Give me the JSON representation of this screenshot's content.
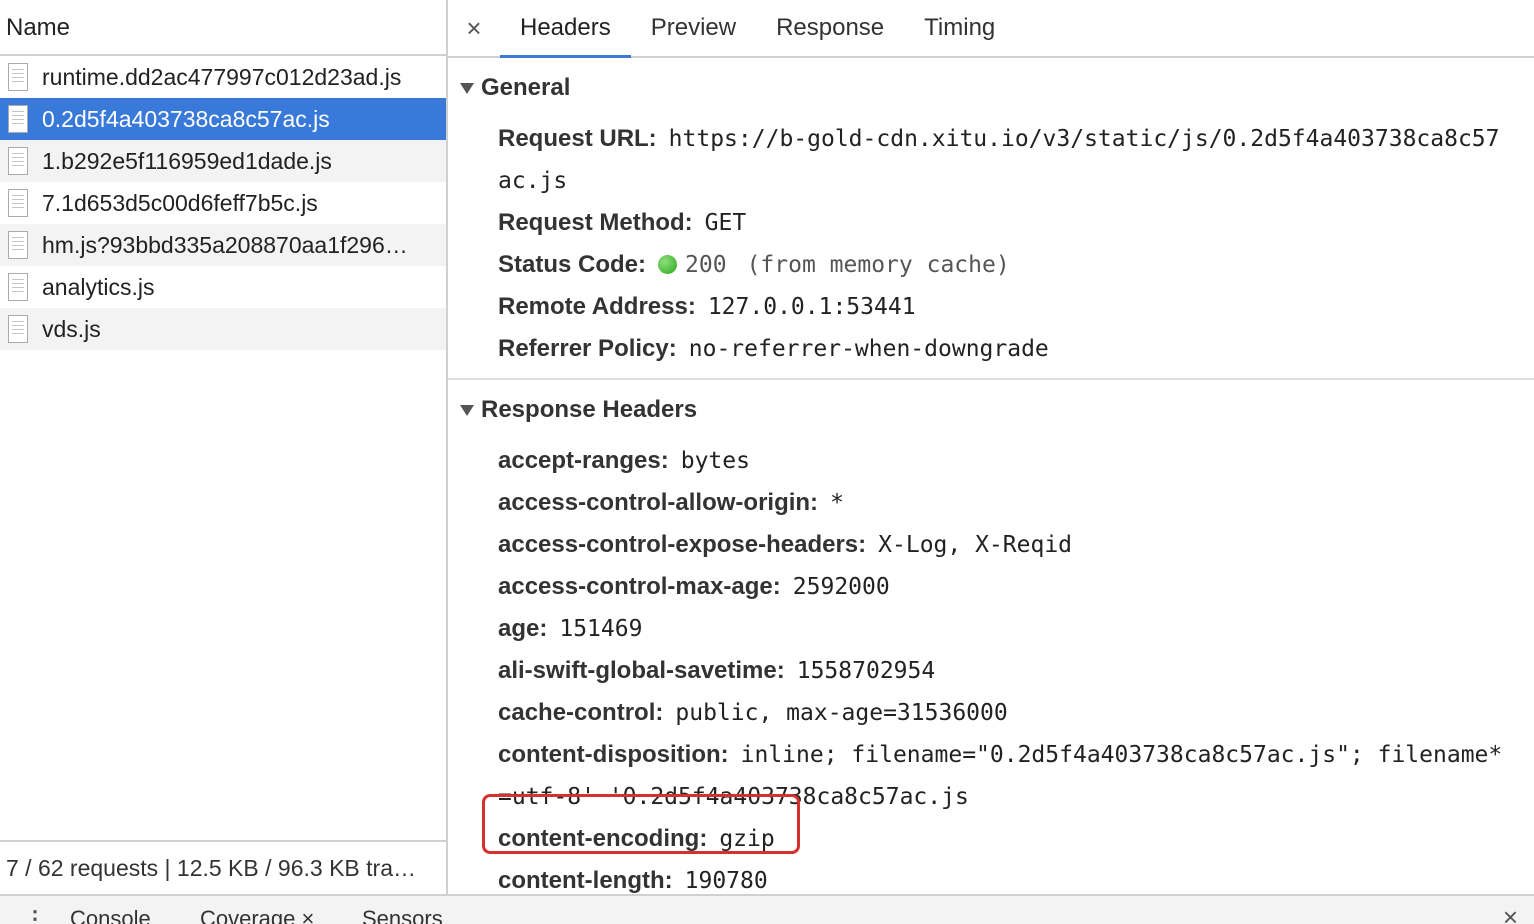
{
  "left_panel": {
    "column_header": "Name",
    "files": [
      {
        "name": "runtime.dd2ac477997c012d23ad.js"
      },
      {
        "name": "0.2d5f4a403738ca8c57ac.js"
      },
      {
        "name": "1.b292e5f116959ed1dade.js"
      },
      {
        "name": "7.1d653d5c00d6feff7b5c.js"
      },
      {
        "name": "hm.js?93bbd335a208870aa1f296…"
      },
      {
        "name": "analytics.js"
      },
      {
        "name": "vds.js"
      }
    ],
    "status": "7 / 62 requests | 12.5 KB / 96.3 KB tra…"
  },
  "tabs": {
    "close_glyph": "×",
    "items": [
      "Headers",
      "Preview",
      "Response",
      "Timing"
    ],
    "active": "Headers"
  },
  "general": {
    "title": "General",
    "request_url_key": "Request URL:",
    "request_url_val": "https://b-gold-cdn.xitu.io/v3/static/js/0.2d5f4a403738ca8c57",
    "request_url_cont": "ac.js",
    "request_method_key": "Request Method:",
    "request_method_val": "GET",
    "status_code_key": "Status Code:",
    "status_code_val": "200",
    "status_code_note": "(from memory cache)",
    "remote_address_key": "Remote Address:",
    "remote_address_val": "127.0.0.1:53441",
    "referrer_policy_key": "Referrer Policy:",
    "referrer_policy_val": "no-referrer-when-downgrade"
  },
  "response_headers": {
    "title": "Response Headers",
    "items": [
      {
        "key": "accept-ranges:",
        "val": "bytes"
      },
      {
        "key": "access-control-allow-origin:",
        "val": "*"
      },
      {
        "key": "access-control-expose-headers:",
        "val": "X-Log, X-Reqid"
      },
      {
        "key": "access-control-max-age:",
        "val": "2592000"
      },
      {
        "key": "age:",
        "val": "151469"
      },
      {
        "key": "ali-swift-global-savetime:",
        "val": "1558702954"
      },
      {
        "key": "cache-control:",
        "val": "public, max-age=31536000"
      },
      {
        "key": "content-disposition:",
        "val": "inline; filename=\"0.2d5f4a403738ca8c57ac.js\"; filename*"
      },
      {
        "key": "",
        "val": "=utf-8' '0.2d5f4a403738ca8c57ac.js"
      },
      {
        "key": "content-encoding:",
        "val": "gzip"
      },
      {
        "key": "content-length:",
        "val": "190780"
      }
    ]
  },
  "drawer": {
    "menu_glyph": "⋮",
    "tabs": [
      "Console",
      "Coverage",
      "Sensors"
    ],
    "close_glyph": "×",
    "drawer_close_glyph": "×"
  },
  "colors": {
    "selection": "#3879d9",
    "status_ok": "#2aa51a",
    "highlight_box": "#d6312c"
  }
}
